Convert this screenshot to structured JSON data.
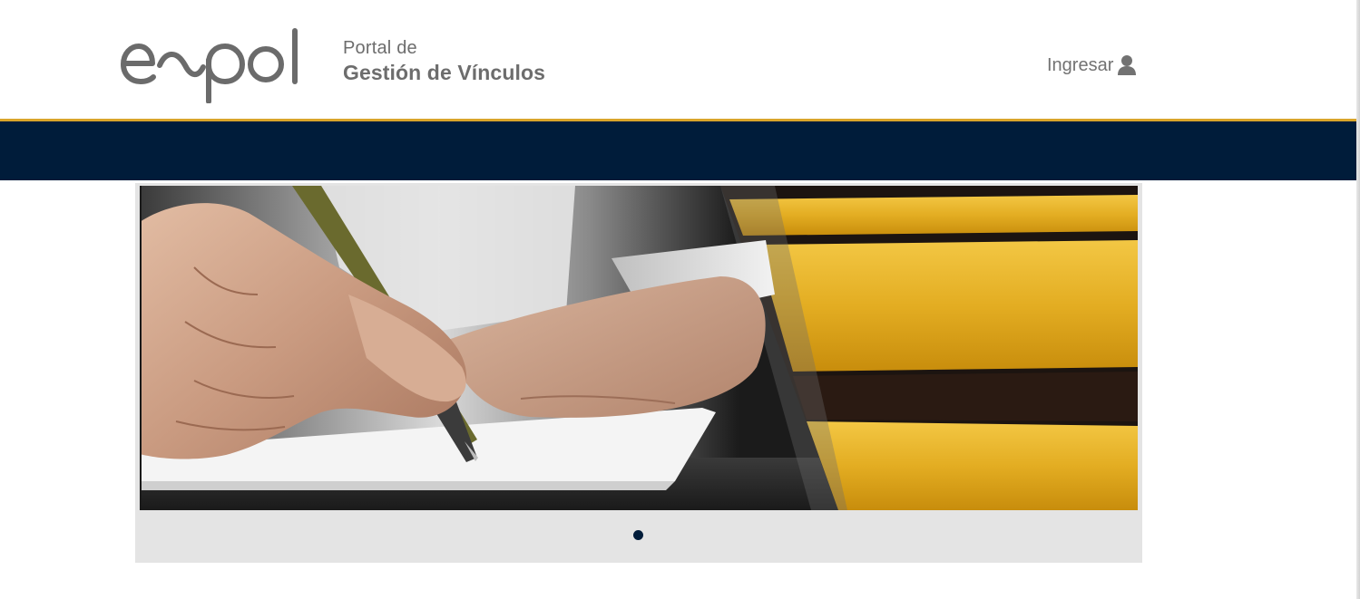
{
  "header": {
    "logo_text": "espol",
    "portal_line1": "Portal de",
    "portal_line2": "Gestión de Vínculos",
    "login_label": "Ingresar",
    "login_icon": "user-icon"
  },
  "colors": {
    "navbar": "#001c3a",
    "accent_line": "#d9a52b",
    "carousel_bg": "#e4e4e4",
    "logo_gray": "#6b6b6b"
  },
  "carousel": {
    "slide_count": 1,
    "active_index": 0,
    "slide_description": "hand-writing-with-pen-on-paper-yellow-folders"
  }
}
